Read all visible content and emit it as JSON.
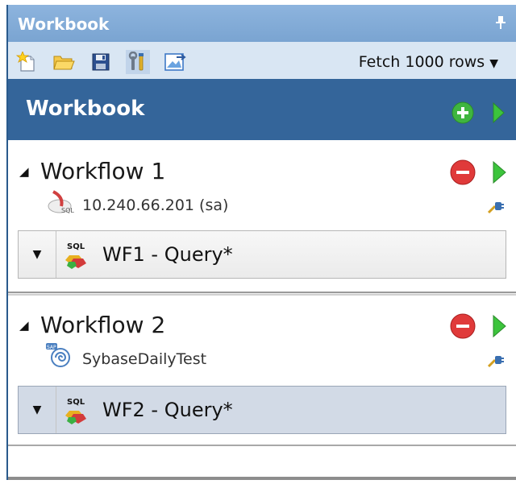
{
  "panel": {
    "title": "Workbook"
  },
  "toolbar": {
    "buttons": [
      {
        "name": "new-workbook",
        "icon": "new-file-star-icon"
      },
      {
        "name": "open",
        "icon": "folder-open-icon"
      },
      {
        "name": "save",
        "icon": "floppy-disk-icon"
      },
      {
        "name": "settings",
        "icon": "wrench-tools-icon"
      },
      {
        "name": "export",
        "icon": "image-export-icon"
      }
    ],
    "fetch_label": "Fetch 1000 rows",
    "fetch_caret": "▼"
  },
  "header": {
    "title": "Workbook"
  },
  "workflows": [
    {
      "toggle": "◢",
      "title": "Workflow 1",
      "connection": "10.240.66.201 (sa)",
      "connection_icon": "sql-server-icon",
      "query": {
        "caret": "▼",
        "label": "WF1 - Query*",
        "selected": false
      }
    },
    {
      "toggle": "◢",
      "title": "Workflow 2",
      "connection": "SybaseDailyTest",
      "connection_icon": "sybase-sap-icon",
      "query": {
        "caret": "▼",
        "label": "WF2 - Query*",
        "selected": true
      }
    }
  ],
  "colors": {
    "title_bar": "#8db4de",
    "toolbar": "#d9e6f3",
    "header": "#34659a",
    "add_green": "#3fb53f",
    "run_green": "#3cc43c",
    "remove_red": "#e03a3a",
    "selected_query": "#d2dae6"
  }
}
